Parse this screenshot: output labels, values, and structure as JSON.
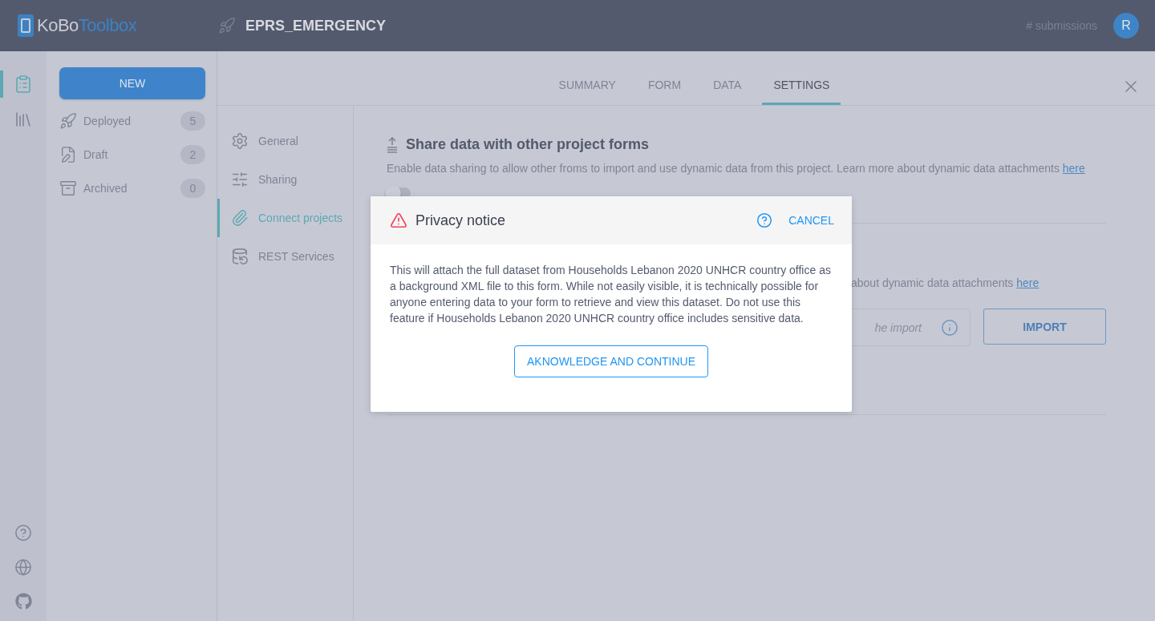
{
  "header": {
    "logo_part1": "KoBo",
    "logo_part2": "Toolbox",
    "project_title": "EPRS_EMERGENCY",
    "submissions": "# submissions",
    "avatar": "R"
  },
  "rail": [
    {
      "kind": "forms",
      "selected": true
    },
    {
      "kind": "library",
      "selected": false
    }
  ],
  "drawer": {
    "new_button": "NEW",
    "items": [
      {
        "kind": "deployed",
        "label": "Deployed",
        "count": "5"
      },
      {
        "kind": "draft",
        "label": "Draft",
        "count": "2"
      },
      {
        "kind": "archived",
        "label": "Archived",
        "count": "0"
      }
    ]
  },
  "tabs": [
    {
      "label": "SUMMARY",
      "selected": false
    },
    {
      "label": "FORM",
      "selected": false
    },
    {
      "label": "DATA",
      "selected": false
    },
    {
      "label": "SETTINGS",
      "selected": true
    }
  ],
  "subnav": [
    {
      "kind": "general",
      "label": "General",
      "selected": false
    },
    {
      "kind": "sharing",
      "label": "Sharing",
      "selected": false
    },
    {
      "kind": "connect",
      "label": "Connect projects",
      "selected": true
    },
    {
      "kind": "rest",
      "label": "REST Services",
      "selected": false
    }
  ],
  "share_section": {
    "title": "Share data with other project forms",
    "description": "Enable data sharing to allow other froms to import and use dynamic data from this project. Learn more about dynamic data attachments",
    "link": "here",
    "toggle": {
      "on": false
    }
  },
  "import_section": {
    "description": "about dynamic data attachments",
    "link": "here",
    "field_placeholder": "he import",
    "import_button": "IMPORT"
  },
  "modal": {
    "title": "Privacy notice",
    "cancel": "CANCEL",
    "body": "This will attach the full dataset from Households Lebanon 2020 UNHCR country office as a background XML file to this form. While not easily visible, it is technically possible for anyone entering data to your form to retrieve and view this dataset. Do not use this feature if Households Lebanon 2020 UNHCR country office includes sensitive data.",
    "confirm": "AKNOWLEDGE AND CONTINUE"
  }
}
